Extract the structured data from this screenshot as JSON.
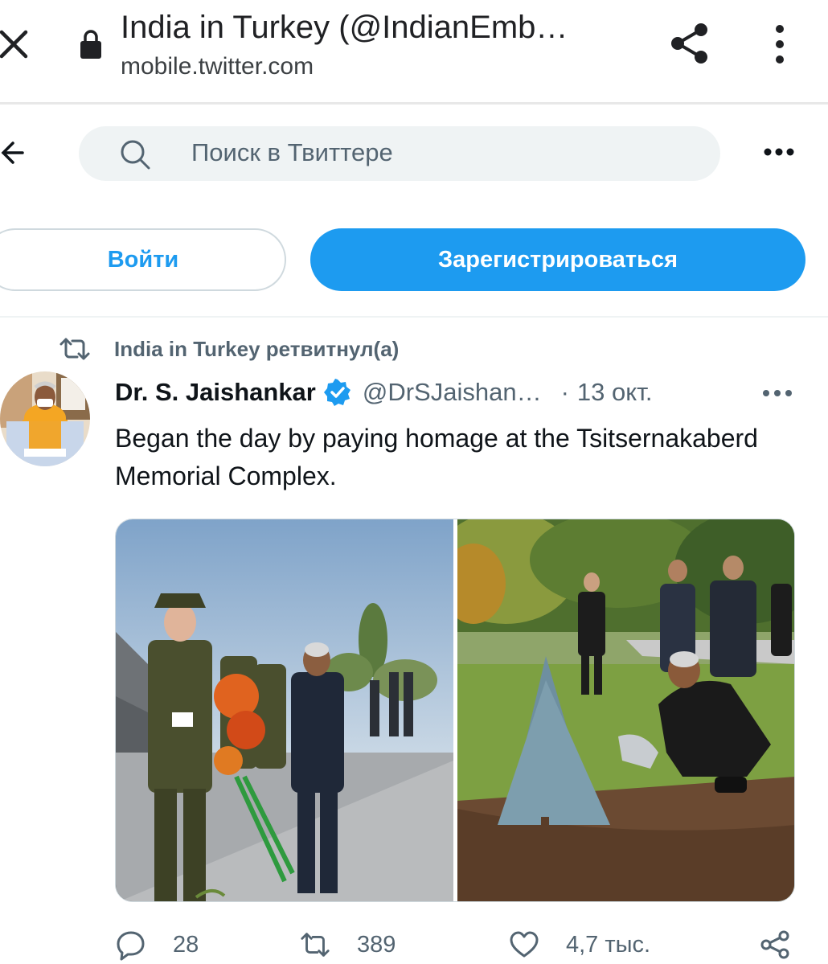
{
  "browser": {
    "title": "India in Turkey (@IndianEmb…",
    "url": "mobile.twitter.com"
  },
  "search": {
    "placeholder": "Поиск в Твиттере"
  },
  "auth": {
    "login_label": "Войти",
    "signup_label": "Зарегистрироваться"
  },
  "tweet": {
    "retweet_label": "India in Turkey ретвитнул(а)",
    "author_name": "Dr. S. Jaishankar",
    "author_handle": "@DrSJaishan…",
    "separator": "·",
    "date": "13 окт.",
    "text": "Began the day by paying homage at the Tsitsernakaberd Memorial Complex.",
    "reply_count": "28",
    "retweet_count": "389",
    "like_count": "4,7 тыс."
  },
  "colors": {
    "accent": "#1d9bf0",
    "muted_text": "#536471",
    "search_bg": "#eff3f4"
  },
  "icons": [
    "close-icon",
    "lock-icon",
    "share-icon",
    "overflow-menu-icon",
    "back-arrow-icon",
    "search-icon",
    "more-icon",
    "retweet-icon",
    "verified-icon",
    "reply-icon",
    "like-icon"
  ]
}
